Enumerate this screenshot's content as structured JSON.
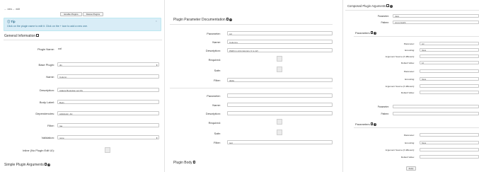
{
  "breadcrumb": "← new ← edit",
  "buttons": {
    "enable": "Enable Plugins",
    "delete": "Delete Plugins",
    "apply": "Apply"
  },
  "tip": {
    "title": "Tip",
    "text": "Click on the plugin name to edit it. Click on the + icon to add a new one.",
    "close": "×"
  },
  "general": {
    "heading": "General Information",
    "plugin_name_label": "Plugin Name:",
    "plugin_name_value": "col",
    "base_plugin_label": "Base Plugin:",
    "base_plugin_value": "div",
    "name_label": "Name:",
    "name_value": "Column",
    "description_label": "Description:",
    "description_value": "Adapts Bootstrap set Div",
    "body_label_label": "Body Label:",
    "body_label_value": "Body",
    "dependencies_label": "Dependencies:",
    "dependencies_value": "wikiplugin_div",
    "filter_label": "Filter:",
    "filter_value": "rae",
    "validation_label": "Validation:",
    "validation_value": "none",
    "inline_label": "Inline (No Plugin Edit UI):"
  },
  "simple_args_heading": "Simple Plugin Arguments",
  "doc": {
    "heading": "Plugin Parameter Documentation",
    "parameter_label": "Parameter:",
    "parameter_value": "col",
    "name_label": "Name:",
    "name_value": "Columns",
    "description_label": "Description:",
    "description_value": "Width in grid columns (1 to 12)",
    "required_label": "Required:",
    "safe_label": "Safe:",
    "filter_label": "Filter:",
    "filter_value": "digits",
    "parameter2_label": "Parameter:",
    "name2_label": "Name:",
    "description2_label": "Description:",
    "required2_label": "Required:",
    "safe2_label": "Safe:",
    "filter2_label": "Filter:",
    "filter2_value": "text"
  },
  "body_heading": "Plugin Body",
  "composed": {
    "heading": "Composed Plugin Arguments",
    "parameter_label": "Parameter:",
    "parameter_value": "class",
    "pattern_label": "Pattern:",
    "pattern_value": "col-xs-%col%",
    "params_heading": "Parameters",
    "p1_parameter_label": "Parameter:",
    "p1_parameter_value": "col",
    "p1_encoding_label": "Encoding:",
    "p1_encoding_value": "None",
    "p1_source_label": "Argument Source (if different):",
    "p1_default_label": "Default Value:",
    "p1_default_value": "12",
    "p2_parameter_label": "Parameter:",
    "p2_encoding_label": "Encoding:",
    "p2_encoding_value": "None",
    "p2_source_label": "Argument Source (if different):",
    "p2_default_label": "Default Value:",
    "parameter2_label": "Parameter:",
    "pattern2_label": "Pattern:",
    "params2_heading": "Parameters",
    "p3_parameter_label": "Parameter:",
    "p3_encoding_label": "Encoding:",
    "p3_encoding_value": "None",
    "p3_source_label": "Argument Source (if different):",
    "p3_default_label": "Default Value:"
  },
  "colors": {
    "tip_bg": "#d9edf7",
    "tip_text": "#31708f"
  }
}
